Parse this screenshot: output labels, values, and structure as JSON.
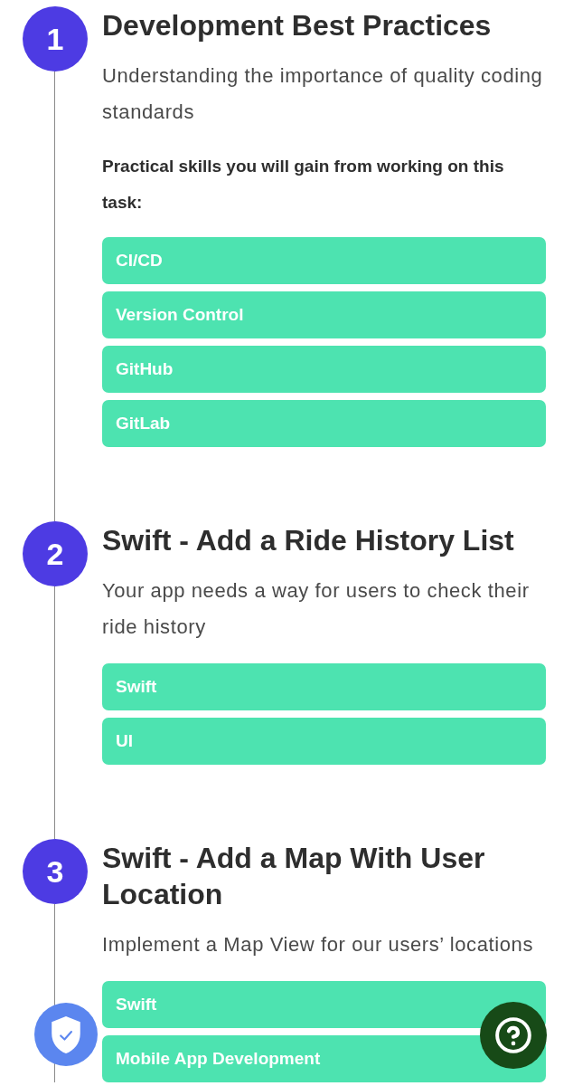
{
  "steps": [
    {
      "number": "1",
      "title": "Development Best Practices",
      "description": "Understanding the importance of quality coding standards",
      "skills_heading": "Practical skills you will gain from working on this task:",
      "skills": [
        "CI/CD",
        "Version Control",
        "GitHub",
        "GitLab"
      ]
    },
    {
      "number": "2",
      "title": "Swift - Add a Ride History List",
      "description": "Your app needs a way for users to check their ride history",
      "skills": [
        "Swift",
        "UI"
      ]
    },
    {
      "number": "3",
      "title": "Swift - Add a Map With User Location",
      "description": "Implement a Map View for our users’ locations",
      "skills": [
        "Swift",
        "Mobile App Development"
      ]
    }
  ]
}
